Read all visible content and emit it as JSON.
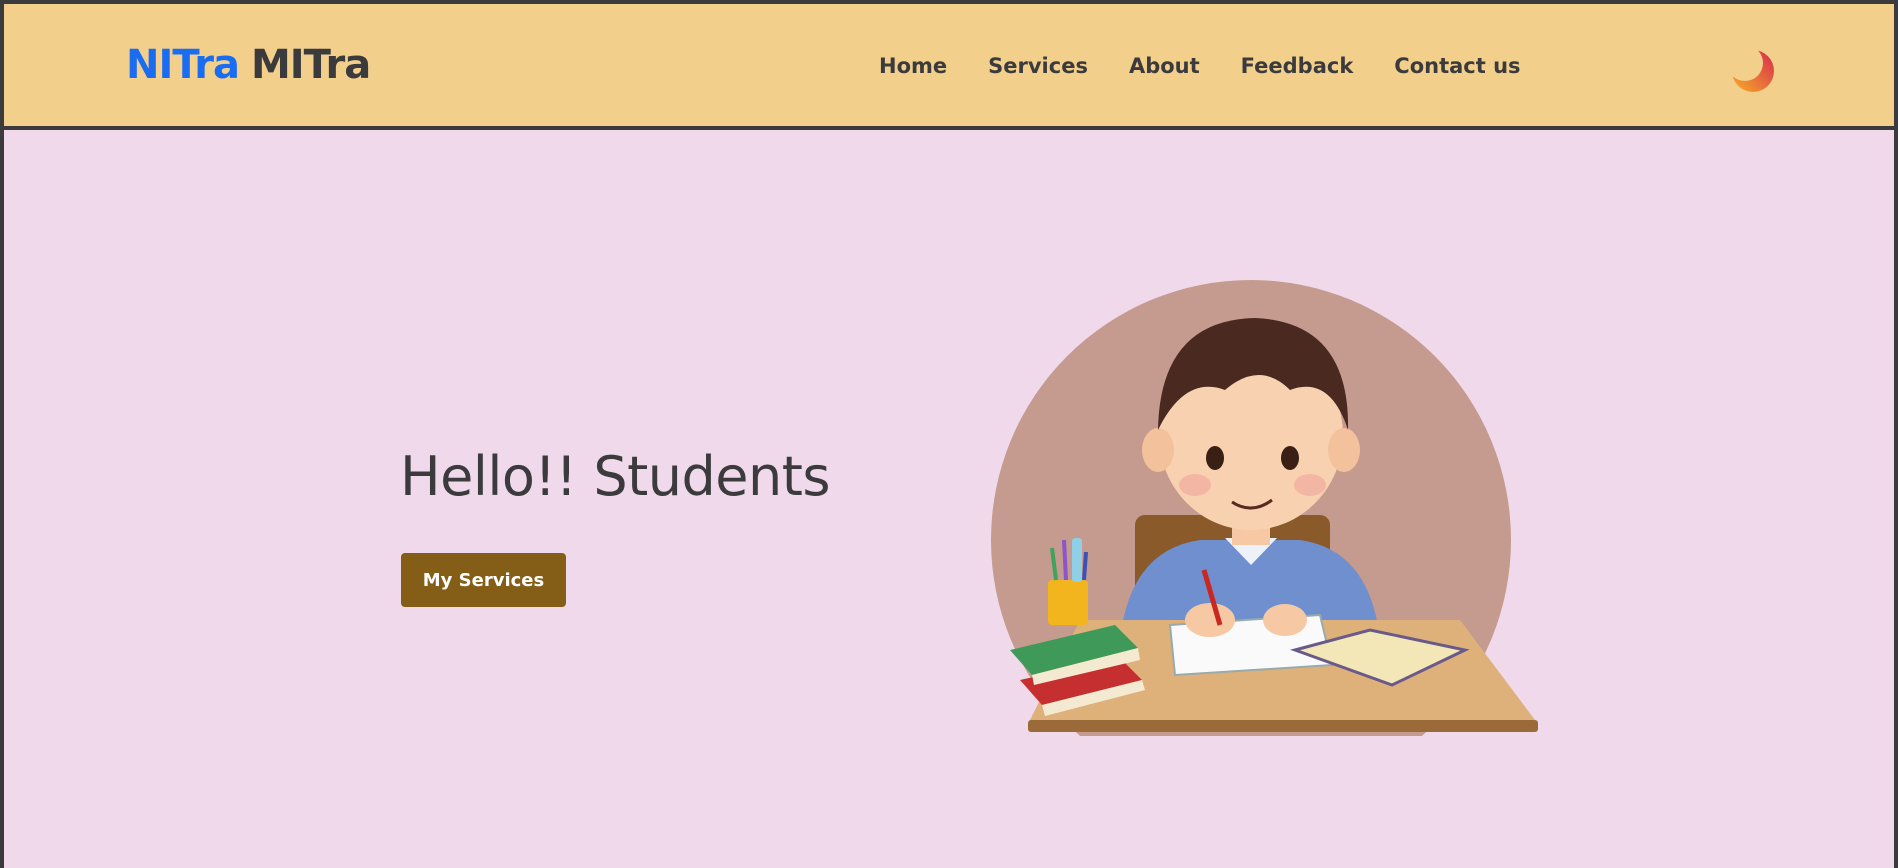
{
  "brand": {
    "part1": "NITra",
    "part2": "MITra"
  },
  "nav": {
    "items": [
      "Home",
      "Services",
      "About",
      "Feedback",
      "Contact us"
    ]
  },
  "theme_toggle": {
    "icon": "moon-icon"
  },
  "hero": {
    "title": "Hello!! Students",
    "cta_label": "My Services",
    "illustration": "student-studying-illustration"
  },
  "colors": {
    "navbar_bg": "#f2d08c",
    "page_bg": "#efd9ea",
    "brand_blue": "#1a6cf0",
    "text_dark": "#3b3a3d",
    "button_bg": "#845e16"
  }
}
